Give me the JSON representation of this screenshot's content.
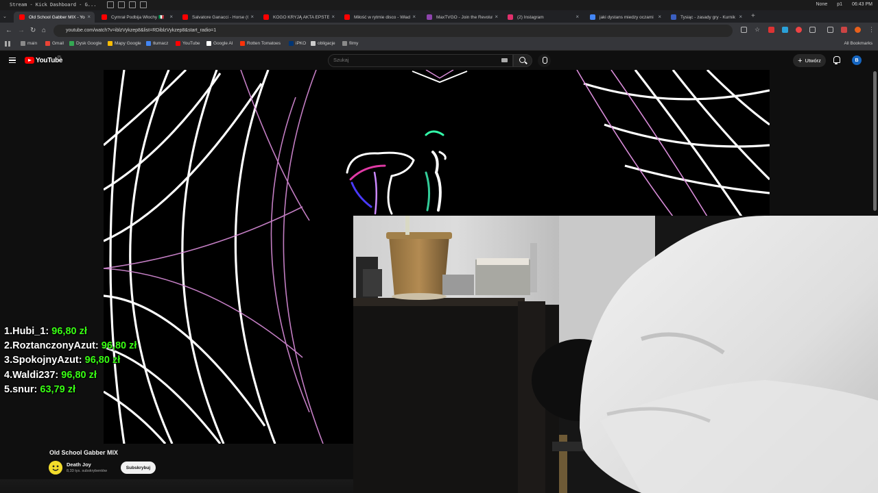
{
  "os": {
    "window_title": "Stream - Kick Dashboard - G...",
    "status_none": "None",
    "status_user": "p1",
    "clock": "06:43 PM"
  },
  "tabs": [
    {
      "label": "Old School Gabber MIX - Yo",
      "color": "#ff0000"
    },
    {
      "label": "Cymrał Podbija Włochy 🇮🇹",
      "color": "#ff0000"
    },
    {
      "label": "Salvatore Ganacci - Horse (C",
      "color": "#ff0000"
    },
    {
      "label": "KOGO KRYJĄ AKTA EPSTEIN",
      "color": "#ff0000"
    },
    {
      "label": "Miłość w rytmie disco - Wład",
      "color": "#ff0000"
    },
    {
      "label": "MaxTVGO - Join the Revolut",
      "color": "#8e44ad"
    },
    {
      "label": "(2) Instagram",
      "color": "#e1306c"
    },
    {
      "label": "jaki dystans miedzy oczami",
      "color": "#4285f4"
    },
    {
      "label": "Tysiąc - zasady gry - Kurnik",
      "color": "#3b5fc0"
    }
  ],
  "address": {
    "url": "youtube.com/watch?v=iblzVykzep8&list=RDiblzVykzep8&start_radio=1"
  },
  "bookmarks": [
    {
      "label": "main",
      "color": "#8a8a8a"
    },
    {
      "label": "Gmail",
      "color": "#ea4335"
    },
    {
      "label": "Dysk Google",
      "color": "#34a853"
    },
    {
      "label": "Mapy Google",
      "color": "#fbbc05"
    },
    {
      "label": "tłumacz",
      "color": "#4285f4"
    },
    {
      "label": "YouTube",
      "color": "#ff0000"
    },
    {
      "label": "Google AI",
      "color": "#ffffff"
    },
    {
      "label": "Rotten Tomatoes",
      "color": "#fa320a"
    },
    {
      "label": "iPKO",
      "color": "#003574"
    },
    {
      "label": "obligacje",
      "color": "#cccccc"
    },
    {
      "label": "filmy",
      "color": "#8a8a8a"
    }
  ],
  "bookmarks_all": "All Bookmarks",
  "youtube": {
    "logo_text": "YouTube",
    "country_code": "PL",
    "search_placeholder": "Szukaj",
    "create_label": "Utwórz",
    "avatar_letter": "B"
  },
  "leaderboard": [
    {
      "rank": "1.",
      "name": "Hubi_1:",
      "amount": "96,80 zł"
    },
    {
      "rank": "2.",
      "name": "RoztanczonyAzut:",
      "amount": "96,80 zł"
    },
    {
      "rank": "3.",
      "name": "SpokojnyAzut:",
      "amount": "96,80 zł"
    },
    {
      "rank": "4.",
      "name": "Waldi237:",
      "amount": "96,80 zł"
    },
    {
      "rank": "5.",
      "name": "snur:",
      "amount": "63,79 zł"
    }
  ],
  "video": {
    "title": "Old School Gabber MIX",
    "channel": "Death Joy",
    "subscribers": "8,33 tys. subskrybentów",
    "subscribe_label": "Subskrybuj"
  },
  "colors": {
    "accent_red": "#ff0000",
    "amount_green": "#39ff14",
    "grid_pink": "#d98cd9"
  }
}
